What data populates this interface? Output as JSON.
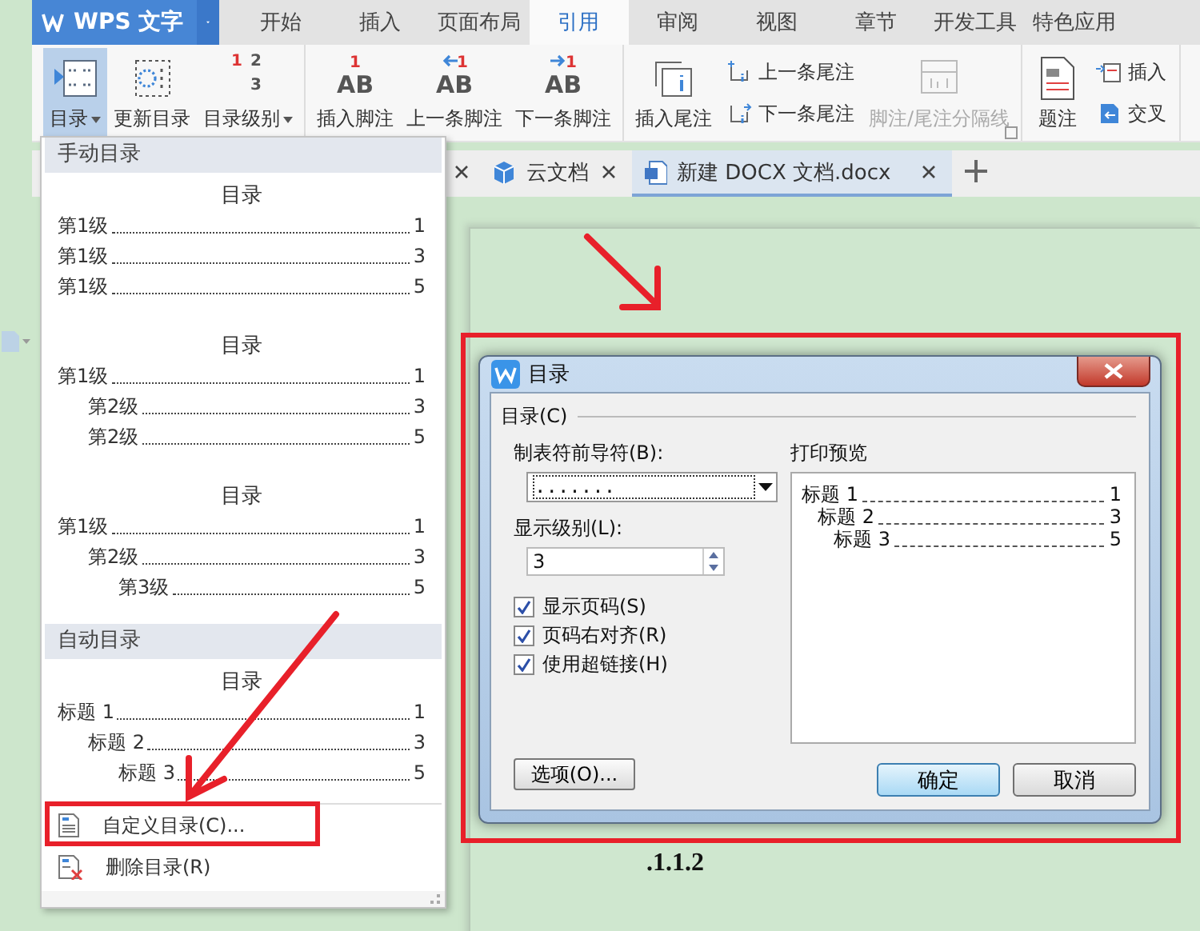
{
  "app_menu": {
    "title": "WPS 文字"
  },
  "ribbon_tabs": [
    {
      "label": "开始",
      "selected": false
    },
    {
      "label": "插入",
      "selected": false
    },
    {
      "label": "页面布局",
      "selected": false
    },
    {
      "label": "引用",
      "selected": true
    },
    {
      "label": "审阅",
      "selected": false
    },
    {
      "label": "视图",
      "selected": false
    },
    {
      "label": "章节",
      "selected": false
    },
    {
      "label": "开发工具",
      "selected": false
    },
    {
      "label": "特色应用",
      "selected": false
    }
  ],
  "ribbon": {
    "groups": [
      {
        "launcher": false,
        "items": [
          {
            "kind": "large",
            "label": "目录",
            "dropdown": true,
            "pressed": true,
            "disabled": false
          },
          {
            "kind": "large",
            "label": "更新目录",
            "dropdown": false,
            "pressed": false,
            "disabled": false
          },
          {
            "kind": "large",
            "digits": [
              "1",
              "2",
              "3"
            ],
            "label": "目录级别",
            "dropdown": true,
            "pressed": false,
            "disabled": false
          }
        ]
      },
      {
        "launcher": false,
        "items": [
          {
            "kind": "large",
            "glyph": "AB",
            "mark": "1",
            "label": "插入脚注",
            "dropdown": false,
            "pressed": false,
            "disabled": false
          },
          {
            "kind": "large",
            "glyph": "AB",
            "mark": "1",
            "label": "上一条脚注",
            "dropdown": false,
            "pressed": false,
            "disabled": false
          },
          {
            "kind": "large",
            "glyph": "AB",
            "mark": "1",
            "label": "下一条脚注",
            "dropdown": false,
            "pressed": false,
            "disabled": false
          }
        ]
      },
      {
        "launcher": true,
        "items": [
          {
            "kind": "large",
            "label": "插入尾注",
            "dropdown": false,
            "pressed": false,
            "disabled": false
          },
          {
            "kind": "stack",
            "items": [
              {
                "label": "上一条尾注"
              },
              {
                "label": "下一条尾注"
              }
            ]
          },
          {
            "kind": "large",
            "label": "脚注/尾注分隔线",
            "dropdown": false,
            "pressed": false,
            "disabled": true
          }
        ]
      },
      {
        "launcher": false,
        "items": [
          {
            "kind": "large",
            "label": "题注",
            "dropdown": false,
            "pressed": false,
            "disabled": false
          },
          {
            "kind": "stack",
            "items": [
              {
                "label": "插入"
              },
              {
                "label": "交叉"
              }
            ]
          }
        ]
      }
    ]
  },
  "document_tabs": [
    {
      "selected": false
    },
    {
      "label": "云文档",
      "selected": false
    },
    {
      "label": "新建 DOCX 文档.docx",
      "selected": true
    }
  ],
  "document": {
    "text": ".1.1.2"
  },
  "toc_menu": {
    "sections": [
      {
        "heading": "手动目录",
        "previews": [
          {
            "title": "目录",
            "entries": [
              {
                "text": "第1级",
                "page": "1"
              },
              {
                "text": "第1级",
                "page": "3"
              },
              {
                "text": "第1级",
                "page": "5"
              }
            ]
          },
          {
            "title": "目录",
            "entries": [
              {
                "text": "第1级",
                "page": "1",
                "children": [
                  {
                    "text": "第2级",
                    "page": "3"
                  },
                  {
                    "text": "第2级",
                    "page": "5"
                  }
                ]
              }
            ]
          },
          {
            "title": "目录",
            "entries": [
              {
                "text": "第1级",
                "page": "1",
                "children": [
                  {
                    "text": "第2级",
                    "page": "3",
                    "children": [
                      {
                        "text": "第3级",
                        "page": "5"
                      }
                    ]
                  }
                ]
              }
            ]
          }
        ]
      },
      {
        "heading": "自动目录",
        "previews": [
          {
            "title": "目录",
            "entries": [
              {
                "text": "标题 1",
                "page": "1",
                "children": [
                  {
                    "text": "标题 2",
                    "page": "3",
                    "children": [
                      {
                        "text": "标题 3",
                        "page": "5"
                      }
                    ]
                  }
                ]
              }
            ]
          }
        ]
      }
    ],
    "commands": [
      {
        "label": "自定义目录(C)..."
      },
      {
        "label": "删除目录(R)"
      }
    ]
  },
  "dialog": {
    "title": "目录",
    "group": "目录(C)",
    "leader_label": "制表符前导符(B):",
    "leader_value": ".......",
    "level_label": "显示级别(L):",
    "level_value": "3",
    "options": [
      {
        "label": "显示页码(S)",
        "checked": true
      },
      {
        "label": "页码右对齐(R)",
        "checked": true
      },
      {
        "label": "使用超链接(H)",
        "checked": true
      }
    ],
    "options_button": "选项(O)...",
    "preview_label": "打印预览",
    "preview": [
      {
        "text": "标题 1",
        "page": "1",
        "children": [
          {
            "text": "标题 2",
            "page": "3",
            "children": [
              {
                "text": "标题 3",
                "page": "5"
              }
            ]
          }
        ]
      }
    ],
    "buttons": [
      {
        "label": "确定",
        "default": true
      },
      {
        "label": "取消",
        "default": false
      }
    ]
  }
}
